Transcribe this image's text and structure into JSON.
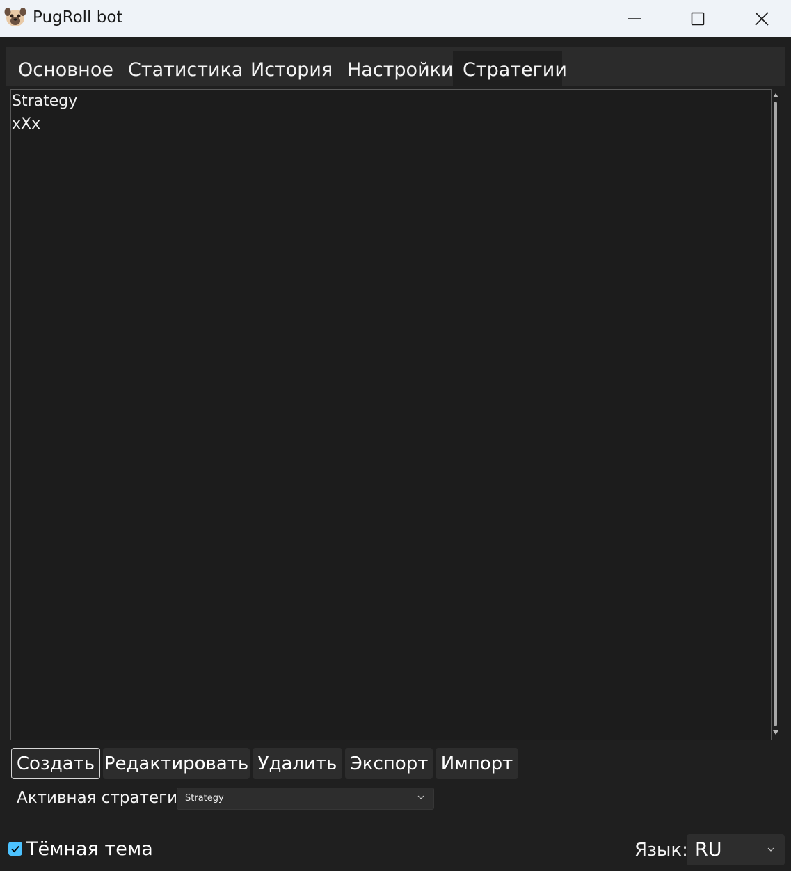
{
  "window": {
    "title": "PugRoll bot",
    "icon": "pug-face-icon"
  },
  "tabs": [
    {
      "label": "Основное",
      "active": false
    },
    {
      "label": "Статистика",
      "active": false
    },
    {
      "label": "История",
      "active": false
    },
    {
      "label": "Настройки",
      "active": false
    },
    {
      "label": "Стратегии",
      "active": true
    }
  ],
  "strategies": {
    "items": [
      "Strategy",
      "xXx"
    ],
    "buttons": {
      "create": "Создать",
      "edit": "Редактировать",
      "delete": "Удалить",
      "export": "Экспорт",
      "import": "Импорт"
    },
    "active_label": "Активная стратегия:",
    "active_value": "Strategy"
  },
  "footer": {
    "dark_theme_label": "Тёмная тема",
    "dark_theme_checked": true,
    "language_label": "Язык:",
    "language_value": "RU"
  },
  "colors": {
    "accent": "#4cc2ff",
    "background": "#1f1f1f",
    "titlebar": "#eff3f8"
  }
}
